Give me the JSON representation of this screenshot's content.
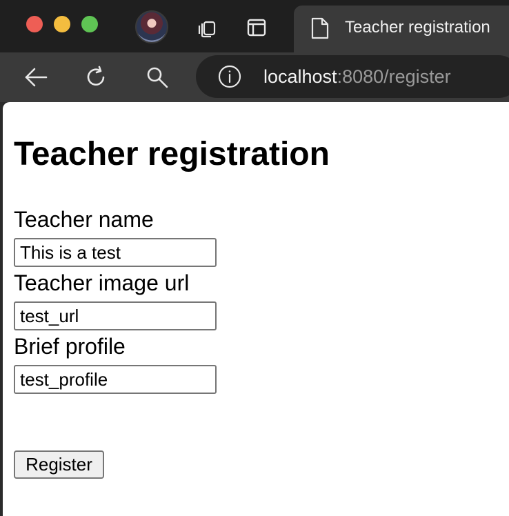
{
  "browser": {
    "tab_title": "Teacher registration",
    "url_host": "localhost",
    "url_rest": ":8080/register",
    "icons": [
      "back-arrow-icon",
      "reload-icon",
      "search-icon",
      "info-icon",
      "tabs-icon",
      "sidebar-icon",
      "document-icon"
    ]
  },
  "page": {
    "heading": "Teacher registration",
    "fields": [
      {
        "label": "Teacher name",
        "value": "This is a test"
      },
      {
        "label": "Teacher image url",
        "value": "test_url"
      },
      {
        "label": "Brief profile",
        "value": "test_profile"
      }
    ],
    "submit_label": "Register"
  }
}
